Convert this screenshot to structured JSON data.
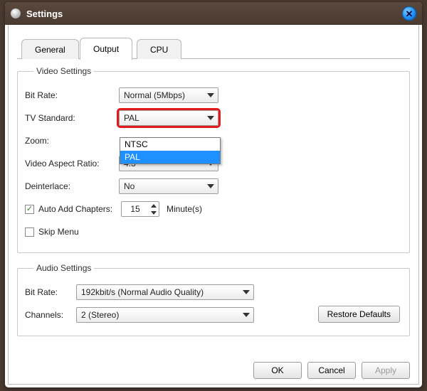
{
  "window": {
    "title": "Settings"
  },
  "tabs": {
    "general": "General",
    "output": "Output",
    "cpu": "CPU"
  },
  "video": {
    "legend": "Video Settings",
    "bitrate_label": "Bit Rate:",
    "bitrate_value": "Normal (5Mbps)",
    "tvstd_label": "TV Standard:",
    "tvstd_value": "PAL",
    "tvstd_options": [
      "NTSC",
      "PAL"
    ],
    "zoom_label": "Zoom:",
    "aspect_label": "Video Aspect Ratio:",
    "aspect_value": "4:3",
    "deint_label": "Deinterlace:",
    "deint_value": "No",
    "autochap_label": "Auto Add Chapters:",
    "autochap_value": "15",
    "autochap_unit": "Minute(s)",
    "skipmenu_label": "Skip Menu"
  },
  "audio": {
    "legend": "Audio Settings",
    "bitrate_label": "Bit Rate:",
    "bitrate_value": "192kbit/s (Normal Audio Quality)",
    "channels_label": "Channels:",
    "channels_value": "2 (Stereo)"
  },
  "buttons": {
    "restore": "Restore Defaults",
    "ok": "OK",
    "cancel": "Cancel",
    "apply": "Apply"
  }
}
